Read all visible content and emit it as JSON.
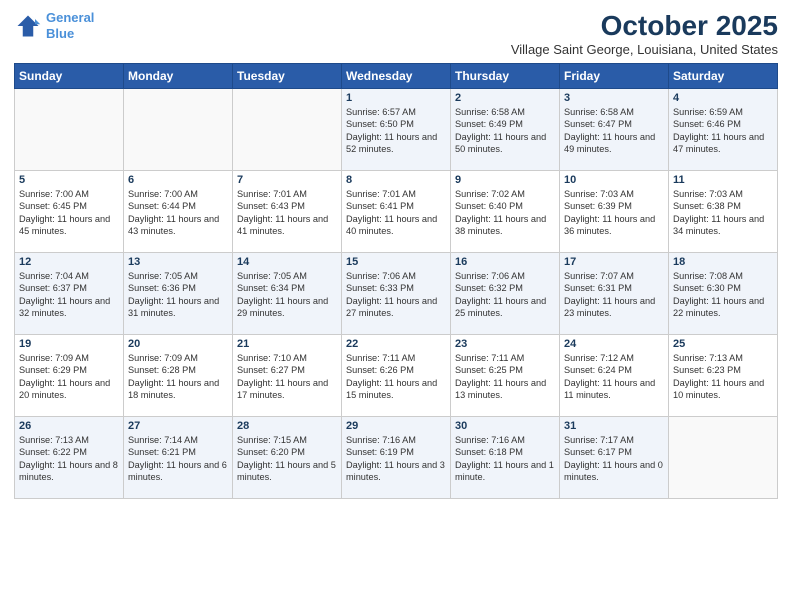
{
  "logo": {
    "line1": "General",
    "line2": "Blue"
  },
  "title": "October 2025",
  "subtitle": "Village Saint George, Louisiana, United States",
  "days_of_week": [
    "Sunday",
    "Monday",
    "Tuesday",
    "Wednesday",
    "Thursday",
    "Friday",
    "Saturday"
  ],
  "weeks": [
    [
      {
        "day": "",
        "text": ""
      },
      {
        "day": "",
        "text": ""
      },
      {
        "day": "",
        "text": ""
      },
      {
        "day": "1",
        "text": "Sunrise: 6:57 AM\nSunset: 6:50 PM\nDaylight: 11 hours and 52 minutes."
      },
      {
        "day": "2",
        "text": "Sunrise: 6:58 AM\nSunset: 6:49 PM\nDaylight: 11 hours and 50 minutes."
      },
      {
        "day": "3",
        "text": "Sunrise: 6:58 AM\nSunset: 6:47 PM\nDaylight: 11 hours and 49 minutes."
      },
      {
        "day": "4",
        "text": "Sunrise: 6:59 AM\nSunset: 6:46 PM\nDaylight: 11 hours and 47 minutes."
      }
    ],
    [
      {
        "day": "5",
        "text": "Sunrise: 7:00 AM\nSunset: 6:45 PM\nDaylight: 11 hours and 45 minutes."
      },
      {
        "day": "6",
        "text": "Sunrise: 7:00 AM\nSunset: 6:44 PM\nDaylight: 11 hours and 43 minutes."
      },
      {
        "day": "7",
        "text": "Sunrise: 7:01 AM\nSunset: 6:43 PM\nDaylight: 11 hours and 41 minutes."
      },
      {
        "day": "8",
        "text": "Sunrise: 7:01 AM\nSunset: 6:41 PM\nDaylight: 11 hours and 40 minutes."
      },
      {
        "day": "9",
        "text": "Sunrise: 7:02 AM\nSunset: 6:40 PM\nDaylight: 11 hours and 38 minutes."
      },
      {
        "day": "10",
        "text": "Sunrise: 7:03 AM\nSunset: 6:39 PM\nDaylight: 11 hours and 36 minutes."
      },
      {
        "day": "11",
        "text": "Sunrise: 7:03 AM\nSunset: 6:38 PM\nDaylight: 11 hours and 34 minutes."
      }
    ],
    [
      {
        "day": "12",
        "text": "Sunrise: 7:04 AM\nSunset: 6:37 PM\nDaylight: 11 hours and 32 minutes."
      },
      {
        "day": "13",
        "text": "Sunrise: 7:05 AM\nSunset: 6:36 PM\nDaylight: 11 hours and 31 minutes."
      },
      {
        "day": "14",
        "text": "Sunrise: 7:05 AM\nSunset: 6:34 PM\nDaylight: 11 hours and 29 minutes."
      },
      {
        "day": "15",
        "text": "Sunrise: 7:06 AM\nSunset: 6:33 PM\nDaylight: 11 hours and 27 minutes."
      },
      {
        "day": "16",
        "text": "Sunrise: 7:06 AM\nSunset: 6:32 PM\nDaylight: 11 hours and 25 minutes."
      },
      {
        "day": "17",
        "text": "Sunrise: 7:07 AM\nSunset: 6:31 PM\nDaylight: 11 hours and 23 minutes."
      },
      {
        "day": "18",
        "text": "Sunrise: 7:08 AM\nSunset: 6:30 PM\nDaylight: 11 hours and 22 minutes."
      }
    ],
    [
      {
        "day": "19",
        "text": "Sunrise: 7:09 AM\nSunset: 6:29 PM\nDaylight: 11 hours and 20 minutes."
      },
      {
        "day": "20",
        "text": "Sunrise: 7:09 AM\nSunset: 6:28 PM\nDaylight: 11 hours and 18 minutes."
      },
      {
        "day": "21",
        "text": "Sunrise: 7:10 AM\nSunset: 6:27 PM\nDaylight: 11 hours and 17 minutes."
      },
      {
        "day": "22",
        "text": "Sunrise: 7:11 AM\nSunset: 6:26 PM\nDaylight: 11 hours and 15 minutes."
      },
      {
        "day": "23",
        "text": "Sunrise: 7:11 AM\nSunset: 6:25 PM\nDaylight: 11 hours and 13 minutes."
      },
      {
        "day": "24",
        "text": "Sunrise: 7:12 AM\nSunset: 6:24 PM\nDaylight: 11 hours and 11 minutes."
      },
      {
        "day": "25",
        "text": "Sunrise: 7:13 AM\nSunset: 6:23 PM\nDaylight: 11 hours and 10 minutes."
      }
    ],
    [
      {
        "day": "26",
        "text": "Sunrise: 7:13 AM\nSunset: 6:22 PM\nDaylight: 11 hours and 8 minutes."
      },
      {
        "day": "27",
        "text": "Sunrise: 7:14 AM\nSunset: 6:21 PM\nDaylight: 11 hours and 6 minutes."
      },
      {
        "day": "28",
        "text": "Sunrise: 7:15 AM\nSunset: 6:20 PM\nDaylight: 11 hours and 5 minutes."
      },
      {
        "day": "29",
        "text": "Sunrise: 7:16 AM\nSunset: 6:19 PM\nDaylight: 11 hours and 3 minutes."
      },
      {
        "day": "30",
        "text": "Sunrise: 7:16 AM\nSunset: 6:18 PM\nDaylight: 11 hours and 1 minute."
      },
      {
        "day": "31",
        "text": "Sunrise: 7:17 AM\nSunset: 6:17 PM\nDaylight: 11 hours and 0 minutes."
      },
      {
        "day": "",
        "text": ""
      }
    ]
  ]
}
